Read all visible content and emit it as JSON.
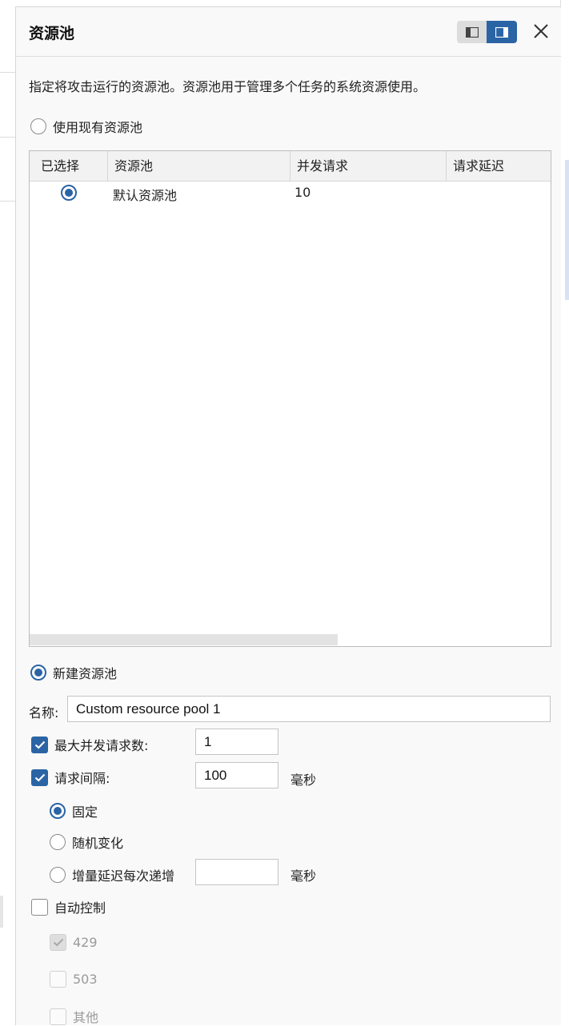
{
  "panel": {
    "title": "资源池",
    "description": "指定将攻击运行的资源池。资源池用于管理多个任务的系统资源使用。",
    "close_icon": "close-icon",
    "layout_toggle": {
      "left_icon": "dock-left-icon",
      "right_icon": "dock-right-icon",
      "active": "right"
    }
  },
  "existing": {
    "label": "使用现有资源池",
    "selected": false,
    "table": {
      "columns": [
        "已选择",
        "资源池",
        "并发请求",
        "请求延迟"
      ],
      "rows": [
        {
          "selected": true,
          "pool": "默认资源池",
          "concurrent": "10",
          "delay": ""
        }
      ]
    }
  },
  "new_pool": {
    "label": "新建资源池",
    "selected": true,
    "name_label": "名称:",
    "name_value": "Custom resource pool 1",
    "max_concurrent": {
      "label": "最大并发请求数:",
      "checked": true,
      "value": "1"
    },
    "interval": {
      "label": "请求间隔:",
      "checked": true,
      "value": "100",
      "unit": "毫秒"
    },
    "interval_modes": [
      {
        "label": "固定",
        "selected": true
      },
      {
        "label": "随机变化",
        "selected": false
      },
      {
        "label": "增量延迟每次递增",
        "selected": false,
        "value": "",
        "unit": "毫秒"
      }
    ],
    "auto_control": {
      "label": "自动控制",
      "checked": false,
      "codes": [
        {
          "label": "429",
          "checked": true,
          "disabled": true
        },
        {
          "label": "503",
          "checked": false,
          "disabled": true
        },
        {
          "label": "其他",
          "checked": false,
          "disabled": true
        }
      ]
    }
  },
  "colors": {
    "accent": "#2a64a5",
    "panel_bg": "#f9f9f9",
    "disabled": "#9a9a9a"
  }
}
